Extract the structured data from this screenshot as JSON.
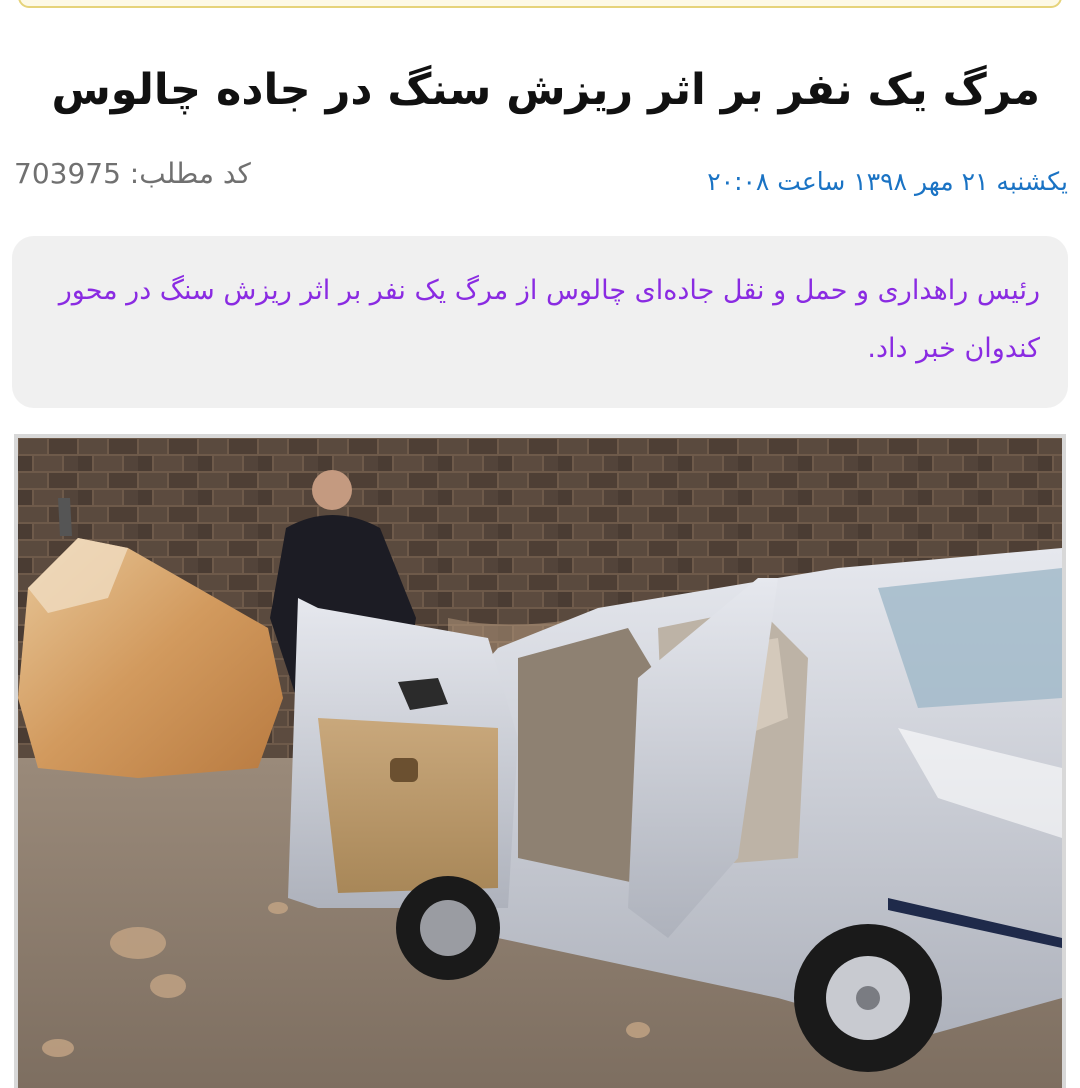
{
  "article": {
    "title": "مرگ یک نفر بر اثر ریزش سنگ در جاده چالوس",
    "date_time": "یکشنبه ۲۱ مهر ۱۳۹۸ ساعت ۲۰:۰۸",
    "code_label": "کد مطلب:",
    "code_value": "703975",
    "lead": "رئیس راهداری و حمل و نقل جاده‌ای چالوس از مرگ یک نفر بر اثر ریزش سنگ در محور کندوان خبر داد."
  },
  "colors": {
    "title": "#111111",
    "date": "#1a73c4",
    "code": "#707070",
    "lead_text": "#8a2be2",
    "lead_background": "#f0f0f0",
    "top_bar_border": "#e6d37a"
  }
}
